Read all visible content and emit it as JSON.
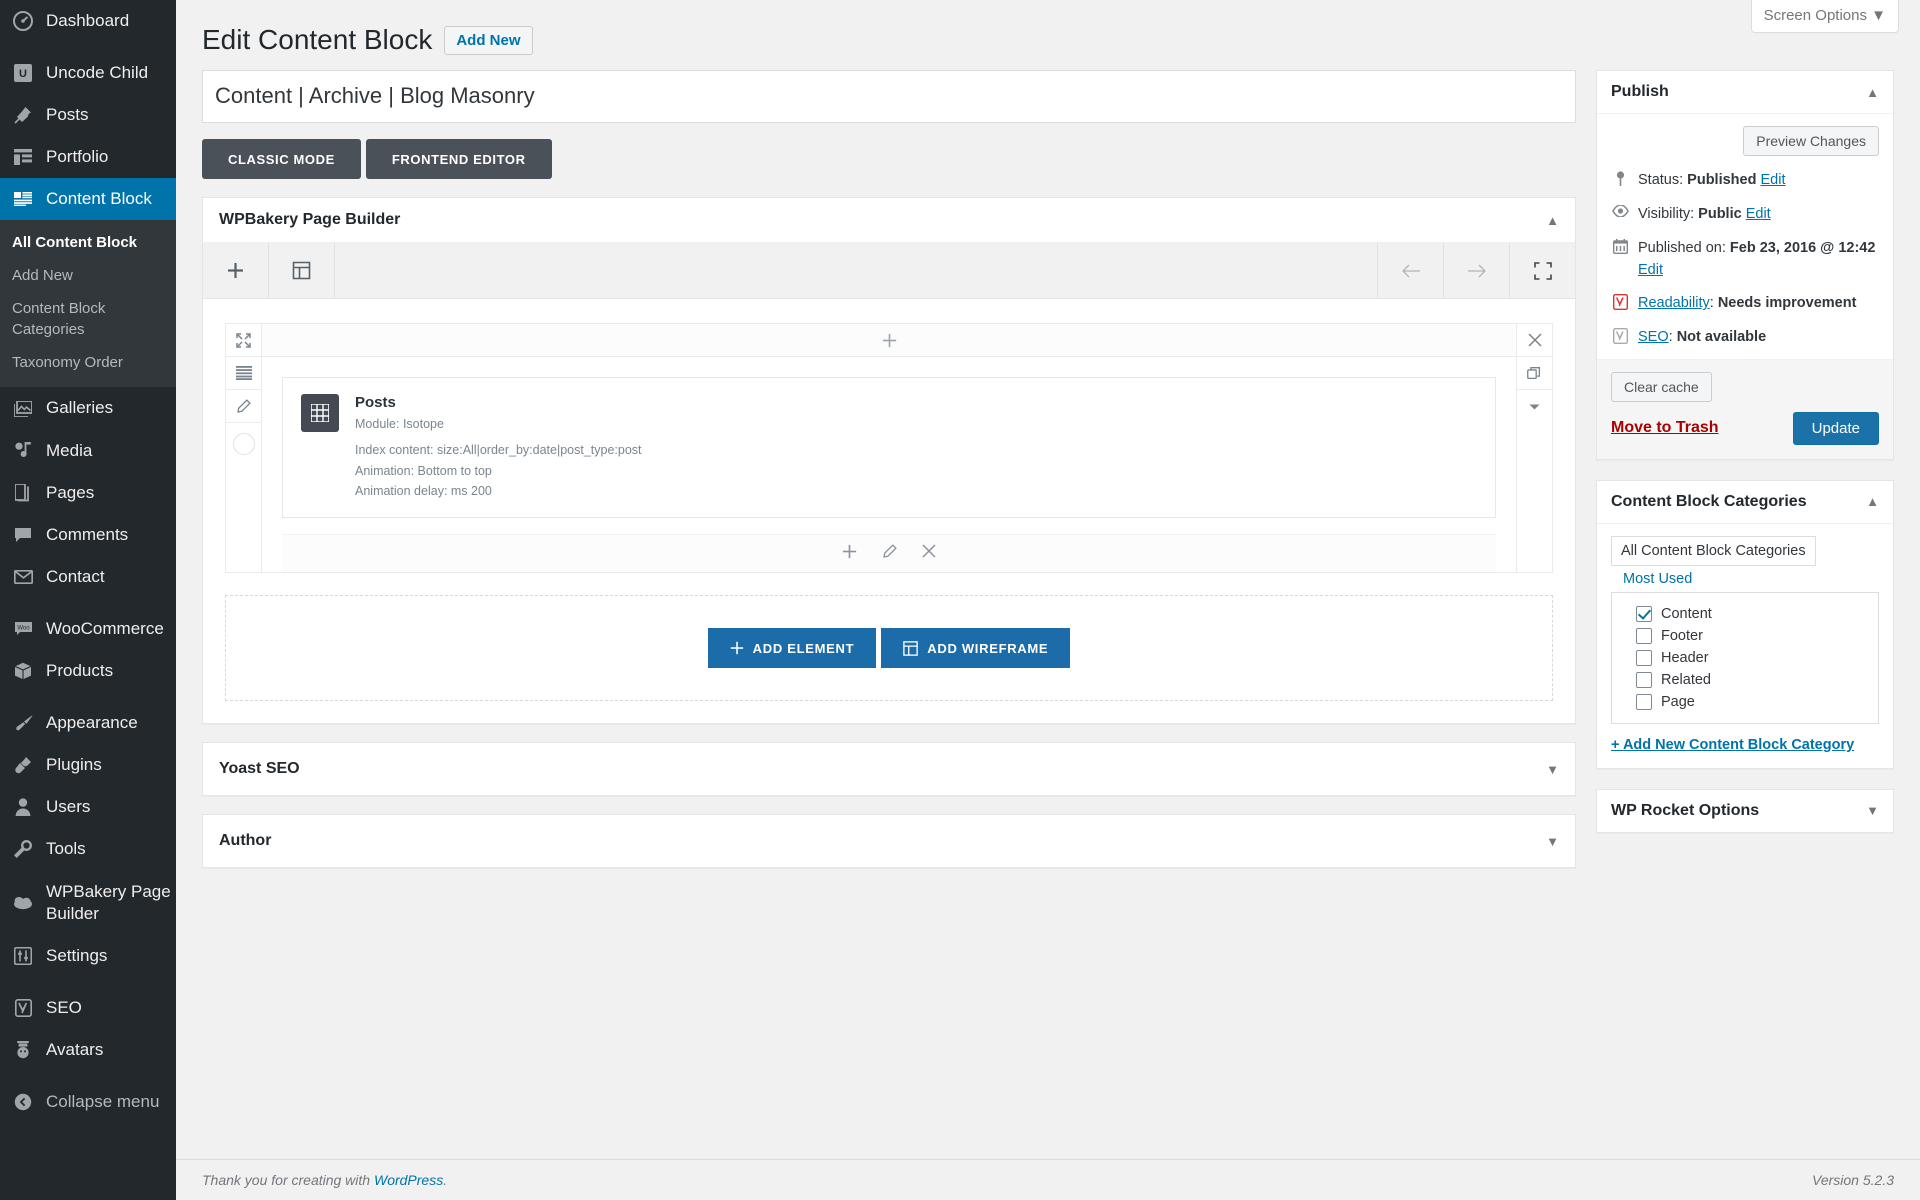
{
  "screen_options": {
    "label": "Screen Options",
    "caret": "▼"
  },
  "sidebar": {
    "items": [
      {
        "label": "Dashboard",
        "icon": "dashboard-icon",
        "current": false,
        "gap_after": true
      },
      {
        "label": "Uncode Child",
        "icon": "uncode-child-icon",
        "current": false
      },
      {
        "label": "Posts",
        "icon": "pin-icon",
        "current": false
      },
      {
        "label": "Portfolio",
        "icon": "portfolio-icon",
        "current": false
      },
      {
        "label": "Content Block",
        "icon": "content-block-icon",
        "current": true
      },
      {
        "label": "Galleries",
        "icon": "galleries-icon",
        "current": false
      },
      {
        "label": "Media",
        "icon": "media-icon",
        "current": false
      },
      {
        "label": "Pages",
        "icon": "pages-icon",
        "current": false
      },
      {
        "label": "Comments",
        "icon": "comments-icon",
        "current": false
      },
      {
        "label": "Contact",
        "icon": "envelope-icon",
        "current": false,
        "gap_after": true
      },
      {
        "label": "WooCommerce",
        "icon": "woocommerce-icon",
        "current": false
      },
      {
        "label": "Products",
        "icon": "products-icon",
        "current": false,
        "gap_after": true
      },
      {
        "label": "Appearance",
        "icon": "appearance-icon",
        "current": false
      },
      {
        "label": "Plugins",
        "icon": "plugins-icon",
        "current": false
      },
      {
        "label": "Users",
        "icon": "users-icon",
        "current": false
      },
      {
        "label": "Tools",
        "icon": "tools-icon",
        "current": false
      },
      {
        "label": "WPBakery Page Builder",
        "icon": "wpbakery-icon",
        "current": false
      },
      {
        "label": "Settings",
        "icon": "settings-icon",
        "current": false,
        "gap_after": true
      },
      {
        "label": "SEO",
        "icon": "yoast-icon",
        "current": false
      },
      {
        "label": "Avatars",
        "icon": "avatars-icon",
        "current": false,
        "gap_after": true
      }
    ],
    "submenu": [
      {
        "label": "All Content Block",
        "current": true
      },
      {
        "label": "Add New",
        "current": false
      },
      {
        "label": "Content Block Categories",
        "current": false
      },
      {
        "label": "Taxonomy Order",
        "current": false
      }
    ],
    "collapse": {
      "label": "Collapse menu",
      "icon": "collapse-arrow-icon"
    }
  },
  "header": {
    "title": "Edit Content Block",
    "add_new": "Add New"
  },
  "title_field": {
    "value": "Content | Archive | Blog Masonry",
    "placeholder": "Add title"
  },
  "mode_buttons": {
    "classic": "CLASSIC MODE",
    "frontend": "FRONTEND EDITOR"
  },
  "builder": {
    "title": "WPBakery Page Builder",
    "toolbar": {
      "add_element": "add-element-icon",
      "templates": "templates-icon",
      "undo": "undo-arrow-icon",
      "redo": "redo-arrow-icon",
      "fullscreen": "fullscreen-icon"
    },
    "element": {
      "name": "Posts",
      "meta": [
        "Module: Isotope",
        "Index content: size:All|order_by:date|post_type:post",
        "Animation: Bottom to top",
        "Animation delay: ms 200"
      ]
    },
    "add_element_label": "ADD ELEMENT",
    "add_wireframe_label": "ADD WIREFRAME"
  },
  "collapsed_boxes": [
    {
      "title": "Yoast SEO",
      "caret": "▼"
    },
    {
      "title": "Author",
      "caret": "▼"
    }
  ],
  "publish": {
    "title": "Publish",
    "caret": "▲",
    "preview_changes": "Preview Changes",
    "rows": [
      {
        "icon": "pin-status-icon",
        "label": "Status:",
        "value": "Published",
        "action": "Edit"
      },
      {
        "icon": "eye-icon",
        "label": "Visibility:",
        "value": "Public",
        "action": "Edit"
      },
      {
        "icon": "calendar-icon",
        "label": "Published on:",
        "value": "Feb 23, 2016 @ 12:42",
        "action": "Edit"
      },
      {
        "icon": "yoast-red-icon",
        "label": "Readability",
        "value": "Needs improvement",
        "link": true
      },
      {
        "icon": "yoast-grey-icon",
        "label": "SEO",
        "value": "Not available",
        "link": true
      }
    ],
    "clear_cache": "Clear cache",
    "move_to_trash": "Move to Trash",
    "update": "Update"
  },
  "categories": {
    "title": "Content Block Categories",
    "caret": "▲",
    "tab_all": "All Content Block Categories",
    "tab_most_used": "Most Used",
    "items": [
      {
        "label": "Content",
        "checked": true
      },
      {
        "label": "Footer",
        "checked": false
      },
      {
        "label": "Header",
        "checked": false
      },
      {
        "label": "Related",
        "checked": false
      },
      {
        "label": "Page",
        "checked": false
      }
    ],
    "add_new": "+ Add New Content Block Category"
  },
  "wp_rocket": {
    "title": "WP Rocket Options",
    "caret": "▼"
  },
  "footer": {
    "thanks_prefix": "Thank you for creating with ",
    "link": "WordPress",
    "thanks_suffix": ".",
    "version": "Version 5.2.3"
  },
  "colors": {
    "accent": "#0073aa",
    "sidebar_bg": "#23282d",
    "submenu_bg": "#32373c",
    "button_dark": "#4a5158",
    "vc_blue": "#1b6ca8"
  }
}
